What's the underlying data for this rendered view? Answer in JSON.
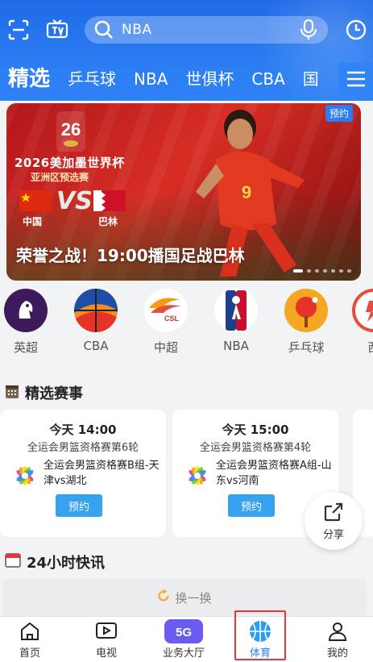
{
  "colors": {
    "accent": "#2b7cf2",
    "header_bg": "#1f6ae8",
    "highlight_box": "#e8333a",
    "booking_button": "#36a2f0"
  },
  "header": {
    "search": {
      "query": "NBA"
    },
    "tabs": [
      {
        "label": "精选",
        "active": true
      },
      {
        "label": "乒乓球"
      },
      {
        "label": "NBA"
      },
      {
        "label": "世俱杯"
      },
      {
        "label": "CBA"
      },
      {
        "label": "国"
      }
    ],
    "icons": [
      "scan-icon",
      "tv-icon",
      "search-icon",
      "mic-icon",
      "history-clock-icon",
      "menu-icon"
    ]
  },
  "banner": {
    "badge": "预约",
    "logo_text": "26",
    "event_title": "2026美加墨世界杯",
    "event_subtitle": "亚洲区预选赛",
    "team_home": "中国",
    "team_away": "巴林",
    "vs": "VS",
    "caption": "荣誉之战！19:00播国足战巴林",
    "player_number": "9",
    "pager": {
      "count": 7,
      "active_index": 0
    }
  },
  "categories": [
    {
      "label": "英超",
      "icon": "premier-league-icon"
    },
    {
      "label": "CBA",
      "icon": "cba-icon"
    },
    {
      "label": "中超",
      "icon": "csl-icon"
    },
    {
      "label": "NBA",
      "icon": "nba-icon"
    },
    {
      "label": "乒乓球",
      "icon": "table-tennis-icon"
    },
    {
      "label": "西",
      "icon": "laliga-icon"
    }
  ],
  "featured": {
    "title": "精选赛事",
    "cards": [
      {
        "time": "今天 14:00",
        "league": "全运会男篮资格赛第6轮",
        "desc": "全运会男篮资格赛B组-天津vs湖北",
        "button": "预约"
      },
      {
        "time": "今天 15:00",
        "league": "全运会男篮资格赛第4轮",
        "desc": "全运会男篮资格赛A组-山东vs河南",
        "button": "预约"
      }
    ]
  },
  "share": {
    "label": "分享"
  },
  "news": {
    "title": "24小时快讯",
    "refresh_label": "换一换"
  },
  "bottom_nav": [
    {
      "label": "首页",
      "icon": "home-icon"
    },
    {
      "label": "电视",
      "icon": "tv-play-icon"
    },
    {
      "label": "业务大厅",
      "icon": "5g-icon",
      "badge": "5G"
    },
    {
      "label": "体育",
      "icon": "basketball-icon",
      "active": true
    },
    {
      "label": "我的",
      "icon": "profile-icon"
    }
  ]
}
